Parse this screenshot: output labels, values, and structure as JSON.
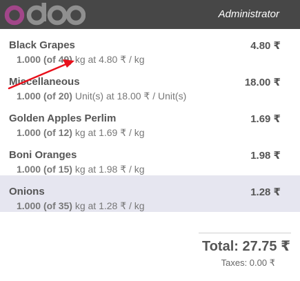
{
  "header": {
    "logo_text": "odoo",
    "user": "Administrator"
  },
  "order_lines": [
    {
      "product": "Black Grapes",
      "qty": "1.000",
      "stock": "(of 49)",
      "detail": "kg at 4.80 ₹ / kg",
      "price": "4.80 ₹",
      "selected": false
    },
    {
      "product": "Miscellaneous",
      "qty": "1.000",
      "stock": "(of 20)",
      "detail": "Unit(s) at 18.00 ₹ / Unit(s)",
      "price": "18.00 ₹",
      "selected": false
    },
    {
      "product": "Golden Apples Perlim",
      "qty": "1.000",
      "stock": "(of 12)",
      "detail": "kg at 1.69 ₹ / kg",
      "price": "1.69 ₹",
      "selected": false
    },
    {
      "product": "Boni Oranges",
      "qty": "1.000",
      "stock": "(of 15)",
      "detail": "kg at 1.98 ₹ / kg",
      "price": "1.98 ₹",
      "selected": false
    },
    {
      "product": "Onions",
      "qty": "1.000",
      "stock": "(of 35)",
      "detail": "kg at 1.28 ₹ / kg",
      "price": "1.28 ₹",
      "selected": true
    }
  ],
  "summary": {
    "total": "Total: 27.75 ₹",
    "taxes": "Taxes: 0.00 ₹"
  },
  "colors": {
    "topbar": "#474747",
    "logo_o": "#a24689",
    "logo_doo": "#8f8f8f",
    "selected_row": "#e6e6f0",
    "arrow": "#e8101b"
  }
}
